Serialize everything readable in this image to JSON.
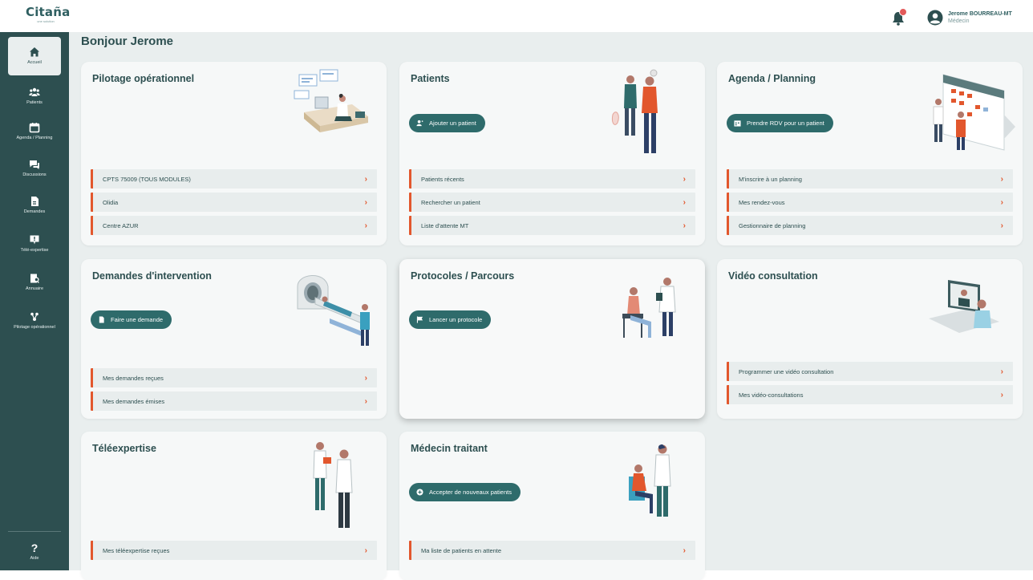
{
  "app": {
    "logo": "Citaña",
    "logo_sub": "une solution"
  },
  "header": {
    "notification_count": "",
    "user_name": "Jerome BOURREAU-MT",
    "user_role": "Médecin"
  },
  "sidebar": {
    "items": [
      {
        "label": "Accueil",
        "icon": "home-icon"
      },
      {
        "label": "Patients",
        "icon": "patients-icon"
      },
      {
        "label": "Agenda / Planning",
        "icon": "calendar-icon"
      },
      {
        "label": "Discussions",
        "icon": "chat-icon"
      },
      {
        "label": "Demandes",
        "icon": "document-icon"
      },
      {
        "label": "Télé-expertise",
        "icon": "teleexpertise-icon"
      },
      {
        "label": "Annuaire",
        "icon": "directory-icon"
      },
      {
        "label": "Pilotage opérationnel",
        "icon": "pilotage-icon"
      }
    ],
    "help_label": "Aide"
  },
  "main": {
    "greeting": "Bonjour Jerome"
  },
  "cards": {
    "pilotage": {
      "title": "Pilotage opérationnel",
      "links": [
        "CPTS 75009 (TOUS MODULES)",
        "Olidia",
        "Centre AZUR"
      ]
    },
    "patients": {
      "title": "Patients",
      "button": "Ajouter un patient",
      "links": [
        "Patients récents",
        "Rechercher un patient",
        "Liste d'attente MT"
      ]
    },
    "agenda": {
      "title": "Agenda / Planning",
      "button": "Prendre RDV pour un patient",
      "links": [
        "M'inscrire à un planning",
        "Mes rendez-vous",
        "Gestionnaire de planning"
      ]
    },
    "demandes": {
      "title": "Demandes d'intervention",
      "button": "Faire une demande",
      "links": [
        "Mes demandes reçues",
        "Mes demandes émises"
      ]
    },
    "protocoles": {
      "title": "Protocoles / Parcours",
      "button": "Lancer un protocole"
    },
    "video": {
      "title": "Vidéo consultation",
      "links": [
        "Programmer une vidéo consultation",
        "Mes vidéo-consultations"
      ]
    },
    "teleexpertise": {
      "title": "Téléexpertise",
      "links": [
        "Mes téléexpertise reçues"
      ]
    },
    "medecin": {
      "title": "Médecin traitant",
      "button": "Accepter de nouveaux patients",
      "links": [
        "Ma liste de patients en attente"
      ]
    }
  },
  "colors": {
    "sidebar": "#2d4f50",
    "accent_button": "#2e6b6b",
    "link_accent": "#e2572d",
    "background": "#e9eeee",
    "notification_badge": "#e35a5a"
  }
}
